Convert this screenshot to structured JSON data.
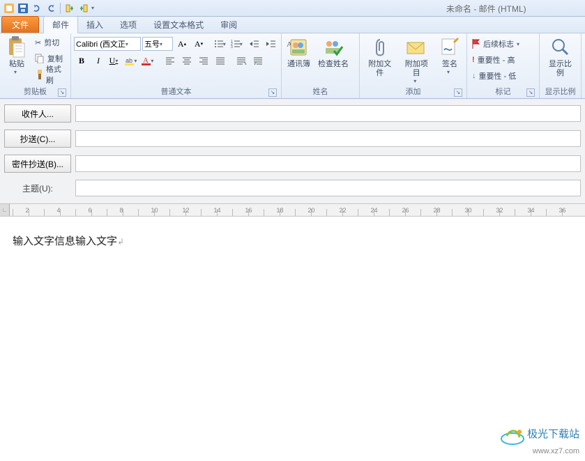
{
  "title": "未命名 - 邮件 (HTML)",
  "tabs": {
    "file": "文件",
    "mail": "邮件",
    "insert": "插入",
    "options": "选项",
    "format": "设置文本格式",
    "review": "审阅"
  },
  "clipboard": {
    "group": "剪贴板",
    "paste": "粘贴",
    "cut": "剪切",
    "copy": "复制",
    "painter": "格式刷"
  },
  "font": {
    "group": "普通文本",
    "family": "Calibri (西文正",
    "size": "五号",
    "bold": "B",
    "italic": "I",
    "underline": "U"
  },
  "names": {
    "group": "姓名",
    "addressbook": "通讯簿",
    "checknames": "检查姓名"
  },
  "include": {
    "group": "添加",
    "attachfile": "附加文件",
    "attachitem": "附加项目",
    "signature": "签名"
  },
  "tags": {
    "group": "标记",
    "followup": "后续标志",
    "high": "重要性 - 高",
    "low": "重要性 - 低"
  },
  "zoom": {
    "group": "显示比例",
    "label": "显示比例"
  },
  "address": {
    "to": "收件人...",
    "cc": "抄送(C)...",
    "bcc": "密件抄送(B)...",
    "subject": "主题(U):"
  },
  "body_text": "输入文字信息输入文字",
  "watermark": {
    "zh": "极光下载站",
    "url": "www.xz7.com"
  },
  "ruler_nums": [
    "2",
    "4",
    "6",
    "8",
    "10",
    "12",
    "14",
    "16",
    "18",
    "20",
    "22",
    "24",
    "26",
    "28",
    "30",
    "32",
    "34",
    "36"
  ]
}
